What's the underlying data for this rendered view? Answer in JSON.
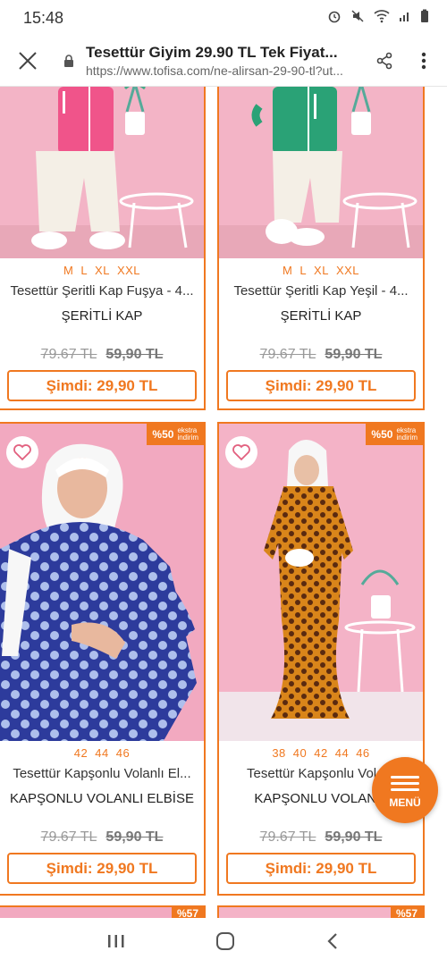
{
  "status": {
    "time": "15:48"
  },
  "browser": {
    "title": "Tesettür Giyim 29.90 TL Tek Fiyat...",
    "url": "https://www.tofisa.com/ne-alirsan-29-90-tl?ut..."
  },
  "products": [
    {
      "sizes": [
        "M",
        "L",
        "XL",
        "XXL"
      ],
      "name": "Tesettür Şeritli Kap Fuşya - 4...",
      "subtitle": "ŞERİTLİ KAP",
      "old_price_1": "79.67 TL",
      "old_price_2": "59,90 TL",
      "now_label": "Şimdi: 29,90 TL",
      "colors": {
        "top": "#f0548a",
        "bottom": "#f2ece2"
      }
    },
    {
      "sizes": [
        "M",
        "L",
        "XL",
        "XXL"
      ],
      "name": "Tesettür Şeritli Kap Yeşil - 4...",
      "subtitle": "ŞERİTLİ KAP",
      "old_price_1": "79.67 TL",
      "old_price_2": "59,90 TL",
      "now_label": "Şimdi: 29,90 TL",
      "colors": {
        "top": "#2aa276",
        "bottom": "#f2ece2"
      }
    },
    {
      "badge_pct": "%50",
      "badge_text_1": "ekstra",
      "badge_text_2": "indirim",
      "sizes": [
        "42",
        "44",
        "46"
      ],
      "name": "Tesettür Kapşonlu Volanlı El...",
      "subtitle": "KAPŞONLU VOLANLI ELBİSE",
      "old_price_1": "79.67 TL",
      "old_price_2": "59,90 TL",
      "now_label": "Şimdi: 29,90 TL",
      "colors": {
        "dress": "#2d3b9c",
        "dots": "#aebfec"
      }
    },
    {
      "badge_pct": "%50",
      "badge_text_1": "ekstra",
      "badge_text_2": "indirim",
      "sizes": [
        "38",
        "40",
        "42",
        "44",
        "46"
      ],
      "name": "Tesettür Kapşonlu Vola...",
      "subtitle": "KAPŞONLU VOLANLI",
      "old_price_1": "79.67 TL",
      "old_price_2": "59,90 TL",
      "now_label": "Şimdi: 29,90 TL",
      "colors": {
        "dress": "#d9851a",
        "dots": "#5a2a10"
      }
    }
  ],
  "next_badges": [
    "%57",
    "%57"
  ],
  "menu_button": {
    "label": "MENÜ"
  },
  "accent_color": "#f07820"
}
